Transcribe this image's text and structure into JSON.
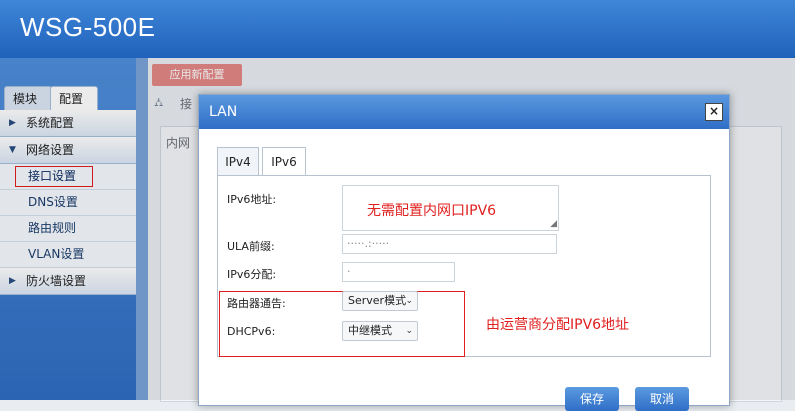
{
  "header": {
    "title": "WSG-500E"
  },
  "sidebar": {
    "tabs": [
      "模块",
      "配置"
    ],
    "sections": [
      {
        "label": "系统配置",
        "arrow": "▶"
      },
      {
        "label": "网络设置",
        "arrow": "▼"
      },
      {
        "label": "防火墙设置",
        "arrow": "▶"
      }
    ],
    "items": [
      "接口设置",
      "DNS设置",
      "路由规则",
      "VLAN设置"
    ]
  },
  "main": {
    "apply_label": "应用新配置",
    "crumb": "接",
    "panel_tab": "内网"
  },
  "dialog": {
    "title": "LAN",
    "close": "×",
    "tabs": [
      "IPv4",
      "IPv6"
    ],
    "fields": {
      "ipv6_addr_label": "IPv6地址:",
      "ula_label": "ULA前缀:",
      "ula_value": "·····.:·····",
      "ipv6_alloc_label": "IPv6分配:",
      "ipv6_alloc_value": "·",
      "router_adv_label": "路由器通告:",
      "router_adv_value": "Server模式",
      "dhcpv6_label": "DHCPv6:",
      "dhcpv6_value": "中继模式"
    },
    "notes": {
      "no_config": "无需配置内网口IPV6",
      "operator": "由运营商分配IPV6地址"
    },
    "buttons": {
      "save": "保存",
      "cancel": "取消"
    }
  },
  "colors": {
    "accent": "#2f6ec6",
    "annotation": "#e0201f"
  }
}
